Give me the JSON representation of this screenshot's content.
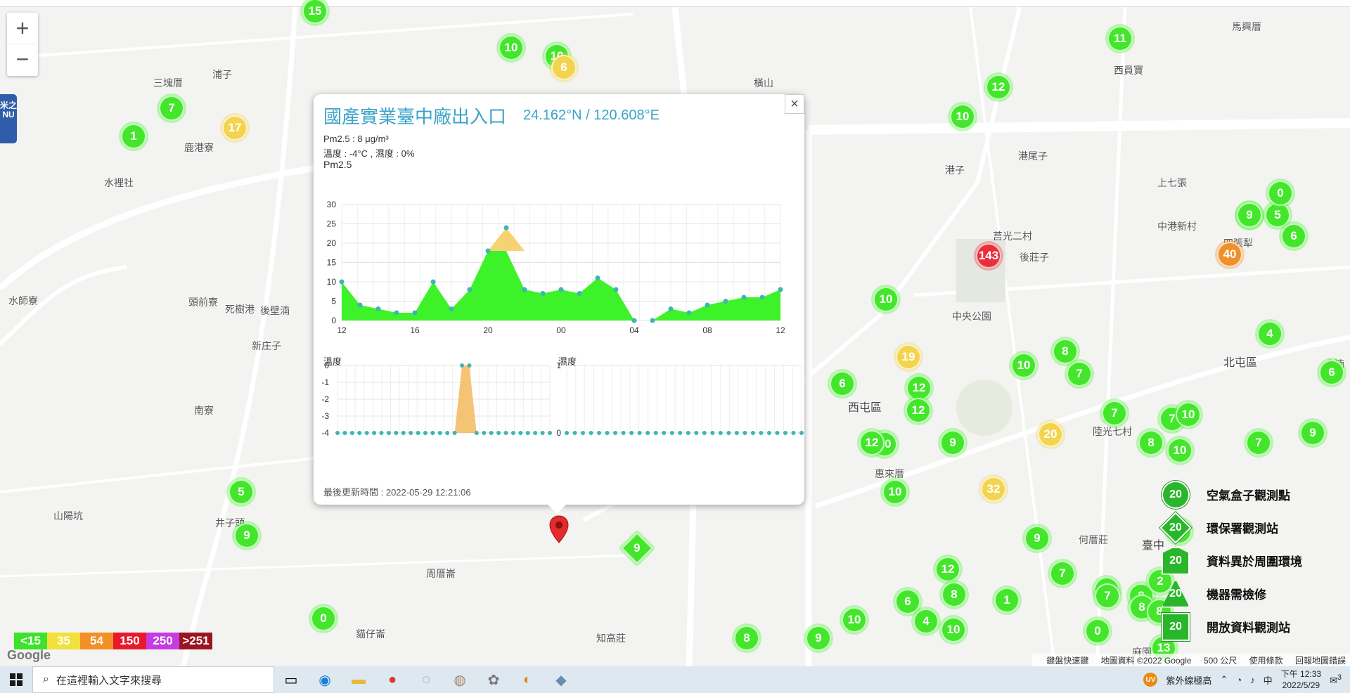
{
  "map": {
    "places": [
      {
        "name": "三塊厝",
        "cls": ""
      },
      {
        "name": "鹿港寮",
        "cls": ""
      },
      {
        "name": "水裡社",
        "cls": ""
      },
      {
        "name": "浦子",
        "cls": ""
      },
      {
        "name": "頭前寮",
        "cls": ""
      },
      {
        "name": "死樹港",
        "cls": ""
      },
      {
        "name": "後壁湳",
        "cls": ""
      },
      {
        "name": "新庄子",
        "cls": ""
      },
      {
        "name": "水師寮",
        "cls": ""
      },
      {
        "name": "南寮",
        "cls": ""
      },
      {
        "name": "山陽坑",
        "cls": ""
      },
      {
        "name": "井子頭",
        "cls": ""
      },
      {
        "name": "周厝崙",
        "cls": ""
      },
      {
        "name": "知高莊",
        "cls": ""
      },
      {
        "name": "貓仔崙",
        "cls": ""
      },
      {
        "name": "橫山",
        "cls": ""
      },
      {
        "name": "港子",
        "cls": ""
      },
      {
        "name": "港尾子",
        "cls": ""
      },
      {
        "name": "馬興厝",
        "cls": ""
      },
      {
        "name": "西員寶",
        "cls": ""
      },
      {
        "name": "莒光二村",
        "cls": ""
      },
      {
        "name": "後莊子",
        "cls": ""
      },
      {
        "name": "中央公園",
        "cls": ""
      },
      {
        "name": "西屯區",
        "cls": "big"
      },
      {
        "name": "惠來厝",
        "cls": ""
      },
      {
        "name": "陸光七村",
        "cls": ""
      },
      {
        "name": "何厝莊",
        "cls": ""
      },
      {
        "name": "上七張",
        "cls": ""
      },
      {
        "name": "中港新村",
        "cls": ""
      },
      {
        "name": "四張犁",
        "cls": ""
      },
      {
        "name": "北屯區",
        "cls": "big"
      },
      {
        "name": "臺中",
        "cls": "big"
      },
      {
        "name": "麻園頭",
        "cls": ""
      },
      {
        "name": "水湳",
        "cls": ""
      }
    ],
    "markers": [
      {
        "v": "15",
        "c": "green"
      },
      {
        "v": "10",
        "c": "green"
      },
      {
        "v": "10",
        "c": "green"
      },
      {
        "v": "6",
        "c": "yellow"
      },
      {
        "v": "7",
        "c": "green"
      },
      {
        "v": "17",
        "c": "yellow"
      },
      {
        "v": "1",
        "c": "green"
      },
      {
        "v": "11",
        "c": "green"
      },
      {
        "v": "12",
        "c": "green"
      },
      {
        "v": "10",
        "c": "green"
      },
      {
        "v": "143",
        "c": "red"
      },
      {
        "v": "10",
        "c": "green"
      },
      {
        "v": "19",
        "c": "yellow"
      },
      {
        "v": "6",
        "c": "green"
      },
      {
        "v": "12",
        "c": "green"
      },
      {
        "v": "12",
        "c": "green"
      },
      {
        "v": "10",
        "c": "green"
      },
      {
        "v": "8",
        "c": "green"
      },
      {
        "v": "7",
        "c": "green"
      },
      {
        "v": "10",
        "c": "green"
      },
      {
        "v": "20",
        "c": "yellow"
      },
      {
        "v": "7",
        "c": "green"
      },
      {
        "v": "7",
        "c": "green"
      },
      {
        "v": "8",
        "c": "green"
      },
      {
        "v": "10",
        "c": "green"
      },
      {
        "v": "12",
        "c": "green"
      },
      {
        "v": "9",
        "c": "green"
      },
      {
        "v": "10",
        "c": "green"
      },
      {
        "v": "32",
        "c": "yellow"
      },
      {
        "v": "9",
        "c": "green"
      },
      {
        "v": "5",
        "c": "green"
      },
      {
        "v": "12",
        "c": "green"
      },
      {
        "v": "8",
        "c": "green"
      },
      {
        "v": "1",
        "c": "green"
      },
      {
        "v": "6",
        "c": "green"
      },
      {
        "v": "4",
        "c": "green"
      },
      {
        "v": "10",
        "c": "green"
      },
      {
        "v": "7",
        "c": "green"
      },
      {
        "v": "0",
        "c": "green"
      },
      {
        "v": "0",
        "c": "green"
      },
      {
        "v": "13",
        "c": "green"
      },
      {
        "v": "10",
        "c": "green"
      },
      {
        "v": "9",
        "c": "green"
      },
      {
        "v": "8",
        "c": "green"
      },
      {
        "v": "0",
        "c": "green"
      },
      {
        "v": "9",
        "c": "green"
      },
      {
        "v": "5",
        "c": "green"
      },
      {
        "v": "0",
        "c": "green"
      },
      {
        "v": "9",
        "c": "green"
      },
      {
        "v": "40",
        "c": "orange"
      },
      {
        "v": "6",
        "c": "green"
      },
      {
        "v": "4",
        "c": "green"
      },
      {
        "v": "6",
        "c": "green"
      },
      {
        "v": "7",
        "c": "green"
      },
      {
        "v": "9",
        "c": "green"
      },
      {
        "v": "10",
        "c": "green"
      },
      {
        "v": "8",
        "c": "green"
      },
      {
        "v": "10",
        "c": "green"
      },
      {
        "v": "8",
        "c": "green"
      },
      {
        "v": "9",
        "c": "green"
      },
      {
        "v": "2",
        "c": "green"
      },
      {
        "v": "7",
        "c": "green"
      },
      {
        "v": "8",
        "c": "green"
      }
    ]
  },
  "zoom": {
    "in": "+",
    "out": "−"
  },
  "sidetab": {
    "label": "米之NU"
  },
  "popup": {
    "title": "國產實業臺中廠出入口",
    "coords": "24.162°N / 120.608°E",
    "pm25_line": "Pm2.5 : 8 μg/m³",
    "temp_line": "溫度 : -4°C , 濕度 : 0%",
    "chart_label": "Pm2.5",
    "temp_label": "溫度",
    "hum_label": "濕度",
    "updated": "最後更新時間 : 2022-05-29 12:21:06",
    "close": "×"
  },
  "chart_data": [
    {
      "type": "area",
      "title": "Pm2.5",
      "x_ticks": [
        "12",
        "16",
        "20",
        "00",
        "04",
        "08",
        "12"
      ],
      "ylim": [
        0,
        30
      ],
      "y_ticks": [
        0,
        5,
        10,
        15,
        20,
        25,
        30
      ],
      "values": [
        10,
        4,
        3,
        2,
        2,
        10,
        3,
        8,
        18,
        24,
        8,
        7,
        8,
        7,
        11,
        8,
        0,
        0,
        3,
        2,
        4,
        5,
        6,
        6,
        8
      ],
      "series_color": "#3ef22a",
      "highlight_color": "#f4d06a"
    },
    {
      "type": "area",
      "title": "溫度",
      "ylim": [
        -4,
        0
      ],
      "y_ticks": [
        0,
        -1,
        -2,
        -3,
        -4
      ],
      "values": [
        -4,
        -4,
        -4,
        -4,
        -4,
        -4,
        -4,
        -4,
        -4,
        -4,
        -4,
        -4,
        -4,
        -4,
        -4,
        -4,
        -4,
        0,
        0,
        -4,
        -4,
        -4,
        -4,
        -4,
        -4,
        -4,
        -4,
        -4,
        -4,
        -4
      ],
      "series_color": "#f3be65"
    },
    {
      "type": "line",
      "title": "濕度",
      "ylim": [
        0,
        1
      ],
      "y_ticks": [
        1,
        0
      ],
      "values": [
        0,
        0,
        0,
        0,
        0,
        0,
        0,
        0,
        0,
        0,
        0,
        0,
        0,
        0,
        0,
        0,
        0,
        0,
        0,
        0,
        0,
        0,
        0,
        0,
        0,
        0,
        0,
        0,
        0,
        0
      ],
      "series_color": "#3db5b5"
    }
  ],
  "scale": [
    {
      "label": "<15",
      "color": "#3ee22b"
    },
    {
      "label": "35",
      "color": "#f1e13a"
    },
    {
      "label": "54",
      "color": "#f29026"
    },
    {
      "label": "150",
      "color": "#e8192c"
    },
    {
      "label": "250",
      "color": "#c53ce0"
    },
    {
      "label": ">251",
      "color": "#9b1421"
    }
  ],
  "google_logo": "Google",
  "legend": [
    {
      "icon": "circle",
      "value": "20",
      "label": "空氣盒子觀測點"
    },
    {
      "icon": "diamond",
      "value": "20",
      "label": "環保署觀測站"
    },
    {
      "icon": "hex",
      "value": "20",
      "label": "資料異於周圍環境"
    },
    {
      "icon": "tri",
      "value": "20",
      "label": "機器需檢修"
    },
    {
      "icon": "square",
      "value": "20",
      "label": "開放資料觀測站"
    }
  ],
  "attrib": {
    "shortcuts": "鍵盤快速鍵",
    "mapdata": "地圖資料 ©2022 Google",
    "scale": "500 公尺",
    "terms": "使用條款",
    "report": "回報地圖錯誤"
  },
  "taskbar": {
    "search_placeholder": "在這裡輸入文字來搜尋",
    "uv_text": "紫外線極高",
    "ime": "中",
    "time": "下午 12:33",
    "date": "2022/5/29",
    "notif": "3"
  }
}
